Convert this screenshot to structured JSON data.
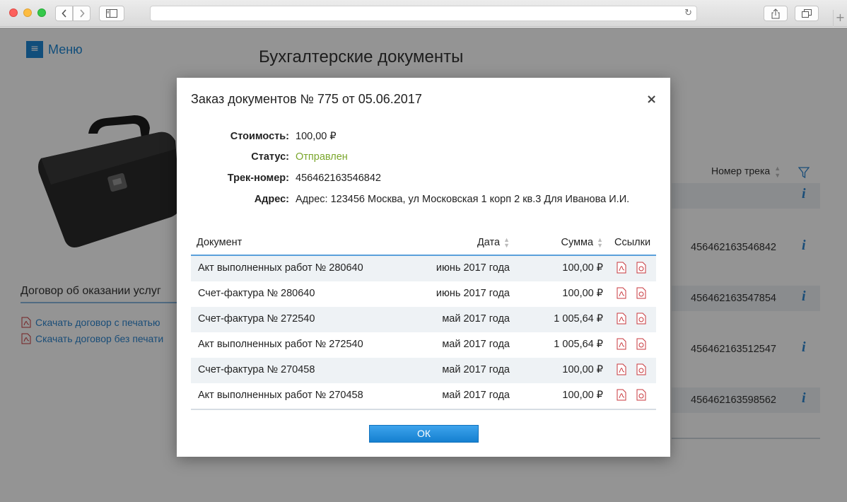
{
  "page": {
    "menu_label": "Меню",
    "title": "Бухгалтерские документы",
    "contract": {
      "title": "Договор об оказании услуг",
      "links": [
        "Скачать договор с печатью",
        "Скачать договор без печати"
      ]
    },
    "bg_table": {
      "track_header": "Номер трека",
      "tracks": [
        "456462163546842",
        "456462163547854",
        "456462163512547",
        "456462163598562"
      ],
      "info_glyph": "i"
    }
  },
  "modal": {
    "title": "Заказ документов № 775 от 05.06.2017",
    "close_glyph": "×",
    "fields": {
      "cost": {
        "label": "Стоимость:",
        "value": "100,00 ₽"
      },
      "status": {
        "label": "Статус:",
        "value": "Отправлен"
      },
      "track": {
        "label": "Трек-номер:",
        "value": "456462163546842"
      },
      "address": {
        "label": "Адрес:",
        "value": "Адрес: 123456 Москва, ул Московская 1 корп 2 кв.3 Для Иванова И.И."
      }
    },
    "table": {
      "headers": {
        "doc": "Документ",
        "date": "Дата",
        "sum": "Сумма",
        "links": "Ссылки"
      },
      "rows": [
        {
          "doc": "Акт выполненных работ № 280640",
          "date": "июнь 2017 года",
          "sum": "100,00 ₽"
        },
        {
          "doc": "Счет-фактура № 280640",
          "date": "июнь 2017 года",
          "sum": "100,00 ₽"
        },
        {
          "doc": "Счет-фактура № 272540",
          "date": "май 2017 года",
          "sum": "1 005,64 ₽"
        },
        {
          "doc": "Акт выполненных работ № 272540",
          "date": "май 2017 года",
          "sum": "1 005,64 ₽"
        },
        {
          "doc": "Счет-фактура № 270458",
          "date": "май 2017 года",
          "sum": "100,00 ₽"
        },
        {
          "doc": "Акт выполненных работ № 270458",
          "date": "май 2017 года",
          "sum": "100,00 ₽"
        }
      ]
    },
    "ok_label": "ОК"
  },
  "colors": {
    "accent": "#1e87d4",
    "status_sent": "#7aa62b",
    "pdf_icon": "#c8373c",
    "row_alt": "#eef2f5"
  },
  "icons": [
    "sidebar-icon",
    "reload-icon",
    "share-icon",
    "tabs-icon",
    "pdf-icon",
    "signed-document-icon",
    "filter-icon",
    "info-icon",
    "briefcase-image"
  ]
}
